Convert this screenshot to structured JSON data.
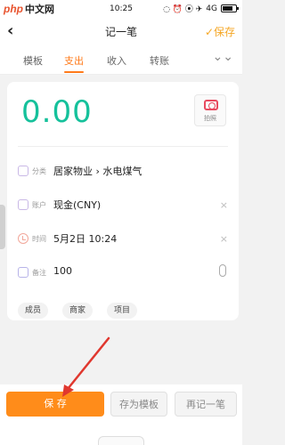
{
  "status_bar": {
    "watermark_php": "php",
    "watermark_cn": "中文网",
    "time": "10:25",
    "signal": "4G",
    "status_icons": "◌ ⏰ ⦿ ✈"
  },
  "header": {
    "back": "‹",
    "title": "记一笔",
    "save": "✓保存"
  },
  "tabs": [
    {
      "label": "模板"
    },
    {
      "label": "支出"
    },
    {
      "label": "收入"
    },
    {
      "label": "转账"
    },
    {
      "label": "⌄⌄"
    }
  ],
  "amount": "0.00",
  "photo_label": "拍照",
  "fields": {
    "category": {
      "key": "分类",
      "value": "居家物业 › 水电煤气"
    },
    "account": {
      "key": "账户",
      "value": "现金(CNY)",
      "clear": "×"
    },
    "time": {
      "key": "时间",
      "value": "5月2日 10:24",
      "clear": "×"
    },
    "note": {
      "key": "备注",
      "value": "100"
    }
  },
  "chips": [
    "成员",
    "商家",
    "项目"
  ],
  "buttons": {
    "save": "保 存",
    "save_template": "存为模板",
    "again": "再记一笔"
  },
  "colors": {
    "accent": "#ff8c1a",
    "amount": "#15c19b",
    "arrow": "#e0382f"
  }
}
